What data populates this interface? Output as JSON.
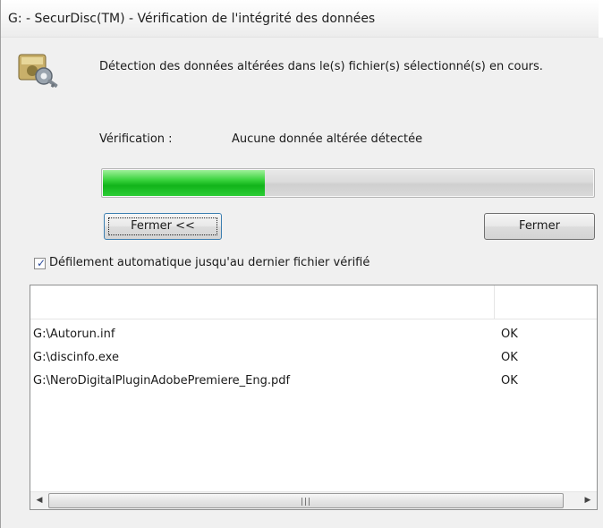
{
  "window": {
    "title": "G: - SecurDisc(TM) - Vérification de l'intégrité des données"
  },
  "message": "Détection des données altérées dans le(s) fichier(s) sélectionné(s) en cours.",
  "verification": {
    "label": "Vérification :",
    "value": "Aucune donnée altérée détectée"
  },
  "progress": {
    "fraction": 0.33
  },
  "buttons": {
    "fermer_details": "Fermer <<",
    "fermer": "Fermer"
  },
  "auto_scroll": {
    "label": "Défilement automatique jusqu'au dernier fichier vérifié",
    "checked": true
  },
  "files": [
    {
      "path": "G:\\Autorun.inf",
      "status": "OK"
    },
    {
      "path": "G:\\discinfo.exe",
      "status": "OK"
    },
    {
      "path": "G:\\NeroDigitalPluginAdobePremiere_Eng.pdf",
      "status": "OK"
    }
  ],
  "icons": {
    "app": "securdisc-key-icon",
    "scroll_left": "scroll-left-arrow-icon",
    "scroll_right": "scroll-right-arrow-icon"
  },
  "colors": {
    "progress_green": "#11b41a",
    "window_bg": "#f0f0f0"
  }
}
